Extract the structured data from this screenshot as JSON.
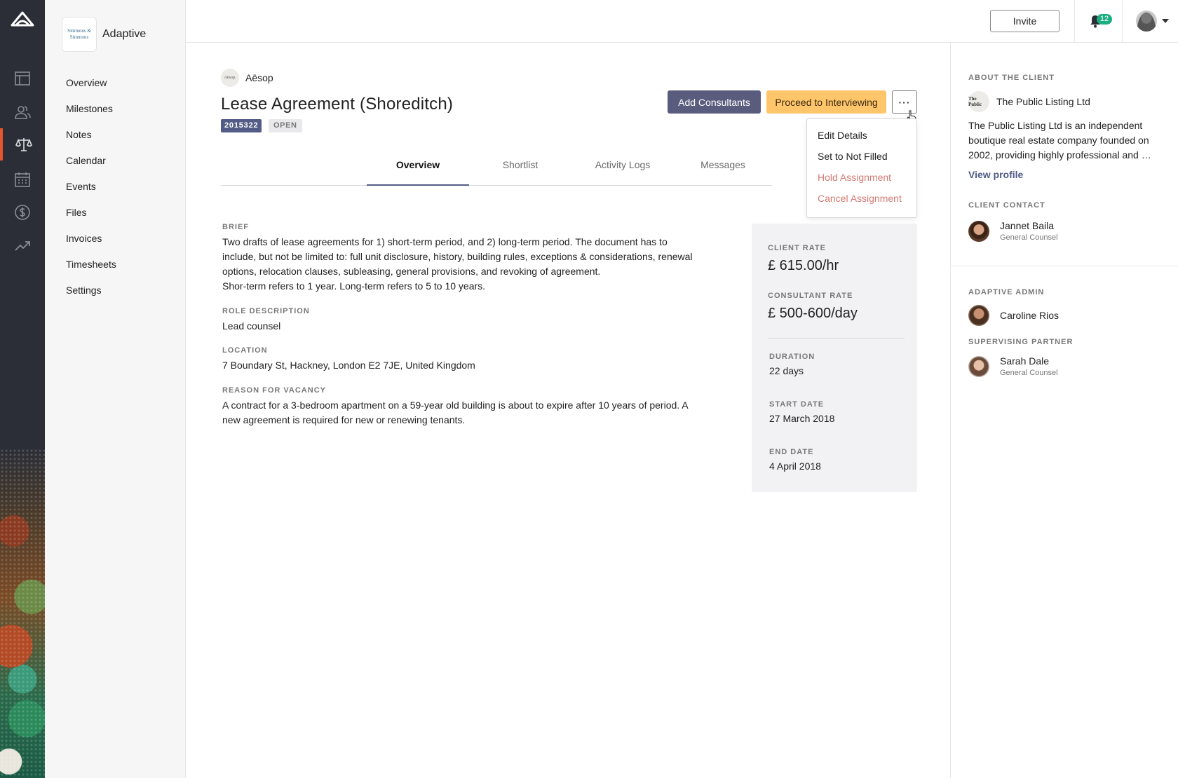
{
  "sidebar": {
    "org_logo_text": "Simmons & Simmons",
    "org_name": "Adaptive",
    "items": [
      {
        "label": "Overview"
      },
      {
        "label": "Milestones"
      },
      {
        "label": "Notes"
      },
      {
        "label": "Calendar"
      },
      {
        "label": "Events"
      },
      {
        "label": "Files"
      },
      {
        "label": "Invoices"
      },
      {
        "label": "Timesheets"
      },
      {
        "label": "Settings"
      }
    ]
  },
  "rail": {
    "icons": [
      "app-logo-icon",
      "layout-icon",
      "people-icon",
      "scales-icon",
      "calendar-icon",
      "dollar-icon",
      "trending-icon"
    ],
    "active": "scales-icon",
    "accent": "#e4572e"
  },
  "topbar": {
    "invite_label": "Invite",
    "notification_count": "12"
  },
  "assignment": {
    "client_logo_text": "Aēsop.",
    "client_name": "Aēsop",
    "title": "Lease Agreement (Shoreditch)",
    "id": "2015322",
    "status": "OPEN",
    "add_consultants_label": "Add Consultants",
    "proceed_label": "Proceed to Interviewing",
    "more_label": "···"
  },
  "menu": {
    "items": [
      "Edit Details",
      "Set to Not Filled",
      "Hold Assignment",
      "Cancel Assignment"
    ]
  },
  "tabs": [
    {
      "label": "Overview"
    },
    {
      "label": "Shortlist"
    },
    {
      "label": "Activity Logs"
    },
    {
      "label": "Messages"
    }
  ],
  "details": {
    "brief_label": "BRIEF",
    "brief_text": "Two drafts of lease agreements for 1) short-term period, and 2) long-term period. The document has to include, but not be limited to: full unit disclosure, history, building rules, exceptions & considerations, renewal options, relocation clauses, subleasing, general provisions, and revoking of agreement.\nShor-term refers to 1 year. Long-term refers to 5 to 10 years.",
    "role_label": "ROLE DESCRIPTION",
    "role_text": "Lead counsel",
    "location_label": "LOCATION",
    "location_text": "7 Boundary St, Hackney, London E2 7JE, United Kingdom",
    "reason_label": "REASON FOR VACANCY",
    "reason_text": "A contract for a 3-bedroom apartment on a 59-year old building is about to expire after 10 years of period. A new agreement is required for new or renewing tenants."
  },
  "rates": {
    "client_rate_label": "CLIENT RATE",
    "client_rate": "£ 615.00/hr",
    "consultant_rate_label": "CONSULTANT RATE",
    "consultant_rate": "£ 500-600/day",
    "duration_label": "DURATION",
    "duration": "22 days",
    "start_label": "START DATE",
    "start": "27 March 2018",
    "end_label": "END DATE",
    "end": "4 April 2018"
  },
  "right_panel": {
    "about_label": "ABOUT THE CLIENT",
    "client_logo_text": "The Public",
    "client_name": "The Public Listing Ltd",
    "about_text": "The Public Listing Ltd is an independent boutique real estate company founded on 2002, providing highly professional and …",
    "view_profile": "View profile",
    "contact_label": "CLIENT CONTACT",
    "contact_name": "Jannet Baila",
    "contact_role": "General Counsel",
    "admin_label": "ADAPTIVE ADMIN",
    "admin_name": "Caroline Rios",
    "partner_label": "SUPERVISING PARTNER",
    "partner_name": "Sarah Dale",
    "partner_role": "General Counsel"
  }
}
